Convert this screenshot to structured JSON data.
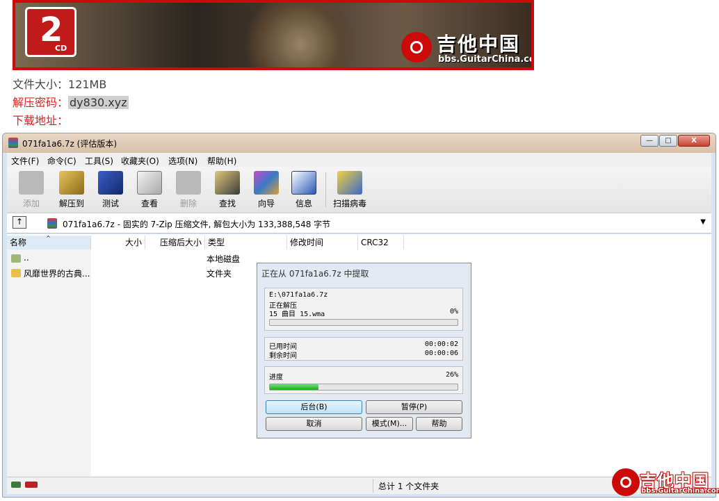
{
  "banner": {
    "cd_number": "2",
    "cd_label": "CD",
    "site_cn": "吉他中国",
    "site_url": "bbs.GuitarChina.com"
  },
  "post": {
    "size_label": "文件大小：",
    "size_value": "121MB",
    "password_label": "解压密码：",
    "password_value": "dy830.xyz",
    "download_label": "下载地址："
  },
  "window": {
    "title": "071fa1a6.7z (评估版本)",
    "controls": {
      "minimize": "—",
      "maximize": "□",
      "close": "X"
    },
    "menu": [
      "文件(F)",
      "命令(C)",
      "工具(S)",
      "收藏夹(O)",
      "选项(N)",
      "帮助(H)"
    ],
    "toolbar": [
      {
        "label": "添加",
        "icon": "add-icon",
        "disabled": true
      },
      {
        "label": "解压到",
        "icon": "extract-icon",
        "disabled": false
      },
      {
        "label": "测试",
        "icon": "test-icon",
        "disabled": false
      },
      {
        "label": "查看",
        "icon": "view-icon",
        "disabled": false
      },
      {
        "label": "删除",
        "icon": "delete-icon",
        "disabled": true
      },
      {
        "label": "查找",
        "icon": "find-icon",
        "disabled": false
      },
      {
        "label": "向导",
        "icon": "wizard-icon",
        "disabled": false
      },
      {
        "label": "信息",
        "icon": "info-icon",
        "disabled": false
      },
      {
        "label": "扫描病毒",
        "icon": "virus-scan-icon",
        "disabled": false
      }
    ],
    "path": "071fa1a6.7z - 固实的 7-Zip 压缩文件, 解包大小为 133,388,548 字节",
    "columns": [
      "名称",
      "大小",
      "压缩后大小",
      "类型",
      "修改时间",
      "CRC32"
    ],
    "rows": [
      {
        "name": "..",
        "type": "本地磁盘"
      },
      {
        "name": "风靡世界的古典...",
        "type": "文件夹"
      }
    ],
    "status": "总计 1 个文件夹"
  },
  "dialog": {
    "title": "正在从 071fa1a6.7z 中提取",
    "archive_path": "E:\\071fa1a6.7z",
    "action": "正在解压",
    "current_file": "15 曲目 15.wma",
    "file_percent": "0%",
    "file_progress": 0,
    "elapsed_label": "已用时间",
    "elapsed": "00:00:02",
    "remaining_label": "剩余时间",
    "remaining": "00:00:06",
    "progress_label": "进度",
    "total_percent": "26%",
    "total_progress": 0.26,
    "buttons": {
      "background": "后台(B)",
      "pause": "暂停(P)",
      "cancel": "取消",
      "mode": "模式(M)...",
      "help": "帮助"
    }
  },
  "watermark": {
    "cn": "吉他中国",
    "url": "bbs.GuitarChina.com"
  }
}
